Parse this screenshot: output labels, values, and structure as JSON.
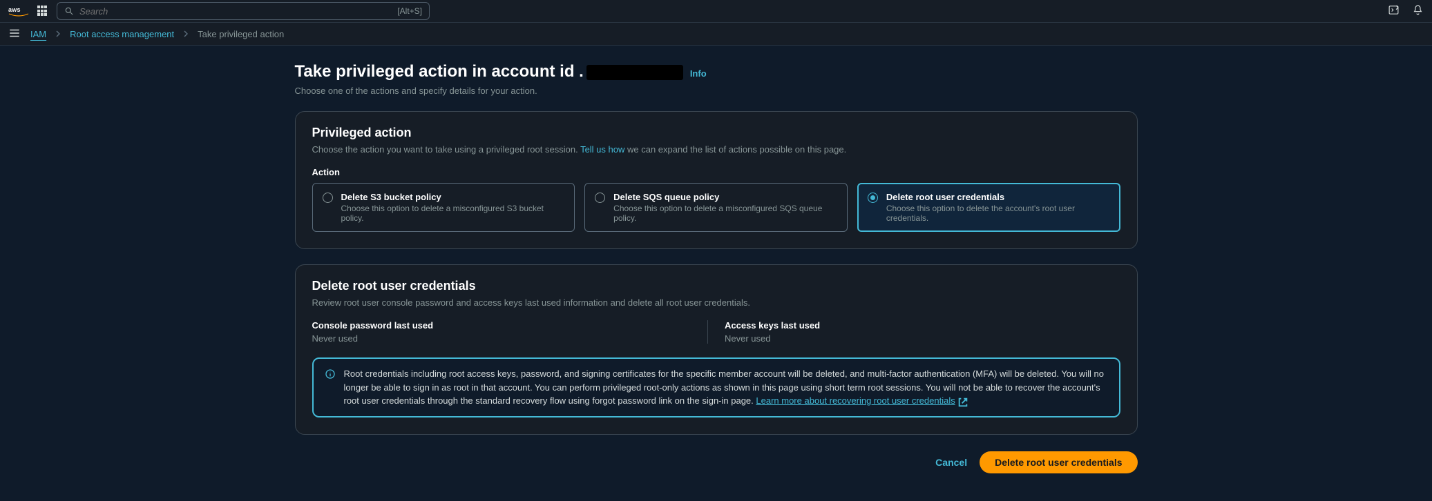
{
  "header": {
    "logo_alt": "aws",
    "search_placeholder": "Search",
    "search_shortcut": "[Alt+S]"
  },
  "breadcrumbs": {
    "items": [
      {
        "label": "IAM",
        "link": true,
        "current": true
      },
      {
        "label": "Root access management",
        "link": true,
        "current": false
      },
      {
        "label": "Take privileged action",
        "link": false,
        "current": false
      }
    ]
  },
  "page": {
    "title_prefix": "Take privileged action in account id .",
    "info_label": "Info",
    "subtitle": "Choose one of the actions and specify details for your action."
  },
  "privileged_panel": {
    "heading": "Privileged action",
    "desc_before": "Choose the action you want to take using a privileged root session. ",
    "desc_link": "Tell us how",
    "desc_after": " we can expand the list of actions possible on this page.",
    "action_label": "Action",
    "actions": [
      {
        "title": "Delete S3 bucket policy",
        "desc": "Choose this option to delete a misconfigured S3 bucket policy.",
        "selected": false
      },
      {
        "title": "Delete SQS queue policy",
        "desc": "Choose this option to delete a misconfigured SQS queue policy.",
        "selected": false
      },
      {
        "title": "Delete root user credentials",
        "desc": "Choose this option to delete the account's root user credentials.",
        "selected": true
      }
    ]
  },
  "credentials_panel": {
    "heading": "Delete root user credentials",
    "desc": "Review root user console password and access keys last used information and delete all root user credentials.",
    "cols": [
      {
        "label": "Console password last used",
        "value": "Never used"
      },
      {
        "label": "Access keys last used",
        "value": "Never used"
      }
    ],
    "alert_text": "Root credentials including root access keys, password, and signing certificates for the specific member account will be deleted, and multi-factor authentication (MFA) will be deleted. You will no longer be able to sign in as root in that account. You can perform privileged root-only actions as shown in this page using short term root sessions. You will not be able to recover the account's root user credentials through the standard recovery flow using forgot password link on the sign-in page. ",
    "alert_link": "Learn more about recovering root user credentials"
  },
  "footer": {
    "cancel": "Cancel",
    "confirm": "Delete root user credentials"
  }
}
